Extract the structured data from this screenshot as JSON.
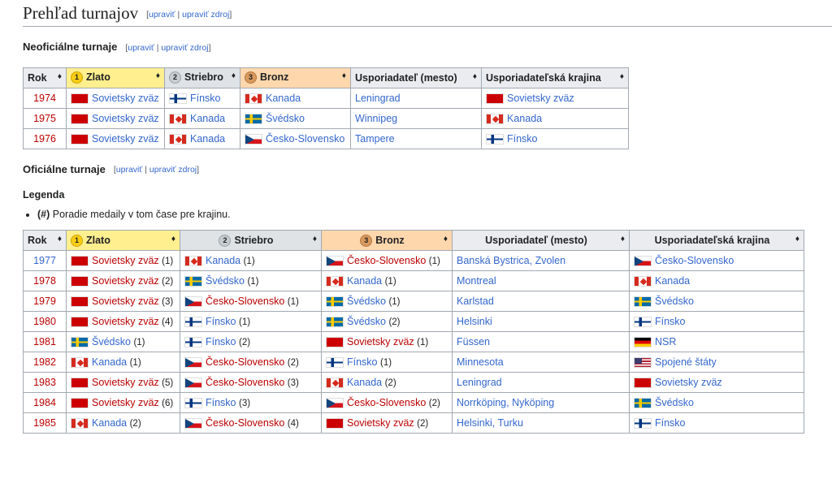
{
  "section_title": "Prehľad turnajov",
  "edit_labels": {
    "open": "[",
    "edit": "upraviť",
    "sep": " | ",
    "edit_src": "upraviť zdroj",
    "close": "]"
  },
  "unofficial": {
    "title": "Neoficiálne turnaje",
    "headers": [
      "Rok",
      "Zlato",
      "Striebro",
      "Bronz",
      "Usporiadateľ (mesto)",
      "Usporiadateľská krajina"
    ],
    "medal_numbers": [
      "1",
      "2",
      "3"
    ],
    "rows": [
      {
        "year": "1974",
        "gold": {
          "flag": "su",
          "name": "Sovietsky zväz"
        },
        "silver": {
          "flag": "fi",
          "name": "Fínsko"
        },
        "bronze": {
          "flag": "ca",
          "name": "Kanada"
        },
        "city": "Leningrad",
        "country": {
          "flag": "su",
          "name": "Sovietsky zväz"
        }
      },
      {
        "year": "1975",
        "gold": {
          "flag": "su",
          "name": "Sovietsky zväz"
        },
        "silver": {
          "flag": "ca",
          "name": "Kanada"
        },
        "bronze": {
          "flag": "se",
          "name": "Švédsko"
        },
        "city": "Winnipeg",
        "country": {
          "flag": "ca",
          "name": "Kanada"
        }
      },
      {
        "year": "1976",
        "gold": {
          "flag": "su",
          "name": "Sovietsky zväz"
        },
        "silver": {
          "flag": "ca",
          "name": "Kanada"
        },
        "bronze": {
          "flag": "cs",
          "name": "Česko-Slovensko"
        },
        "city": "Tampere",
        "country": {
          "flag": "fi",
          "name": "Fínsko"
        }
      }
    ]
  },
  "official": {
    "title": "Oficiálne turnaje",
    "legend_title": "Legenda",
    "legend_item_key": "(#)",
    "legend_item_text": " Poradie medaily v tom čase pre krajinu.",
    "headers": [
      "Rok",
      "Zlato",
      "Striebro",
      "Bronz",
      "Usporiadateľ (mesto)",
      "Usporiadateľská krajina"
    ],
    "rows": [
      {
        "year": "1977",
        "gold": {
          "flag": "su",
          "name": "Sovietsky zväz",
          "n": "(1)",
          "red": true
        },
        "silver": {
          "flag": "ca",
          "name": "Kanada",
          "n": "(1)"
        },
        "bronze": {
          "flag": "cs",
          "name": "Česko-Slovensko",
          "n": "(1)",
          "red": true
        },
        "city": "Banská Bystrica, Zvolen",
        "country": {
          "flag": "cs",
          "name": "Česko-Slovensko"
        }
      },
      {
        "year": "1978",
        "gold": {
          "flag": "su",
          "name": "Sovietsky zväz",
          "n": "(2)",
          "red": true
        },
        "silver": {
          "flag": "se",
          "name": "Švédsko",
          "n": "(1)"
        },
        "bronze": {
          "flag": "ca",
          "name": "Kanada",
          "n": "(1)"
        },
        "city": "Montreal",
        "country": {
          "flag": "ca",
          "name": "Kanada"
        }
      },
      {
        "year": "1979",
        "gold": {
          "flag": "su",
          "name": "Sovietsky zväz",
          "n": "(3)",
          "red": true
        },
        "silver": {
          "flag": "cs",
          "name": "Česko-Slovensko",
          "n": "(1)",
          "red": true
        },
        "bronze": {
          "flag": "se",
          "name": "Švédsko",
          "n": "(1)"
        },
        "city": "Karlstad",
        "country": {
          "flag": "se",
          "name": "Švédsko"
        }
      },
      {
        "year": "1980",
        "gold": {
          "flag": "su",
          "name": "Sovietsky zväz",
          "n": "(4)",
          "red": true
        },
        "silver": {
          "flag": "fi",
          "name": "Fínsko",
          "n": "(1)"
        },
        "bronze": {
          "flag": "se",
          "name": "Švédsko",
          "n": "(2)"
        },
        "city": "Helsinki",
        "country": {
          "flag": "fi",
          "name": "Fínsko"
        }
      },
      {
        "year": "1981",
        "gold": {
          "flag": "se",
          "name": "Švédsko",
          "n": "(1)"
        },
        "silver": {
          "flag": "fi",
          "name": "Fínsko",
          "n": "(2)"
        },
        "bronze": {
          "flag": "su",
          "name": "Sovietsky zväz",
          "n": "(1)",
          "red": true
        },
        "city": "Füssen",
        "country": {
          "flag": "de",
          "name": "NSR"
        }
      },
      {
        "year": "1982",
        "gold": {
          "flag": "ca",
          "name": "Kanada",
          "n": "(1)"
        },
        "silver": {
          "flag": "cs",
          "name": "Česko-Slovensko",
          "n": "(2)",
          "red": true
        },
        "bronze": {
          "flag": "fi",
          "name": "Fínsko",
          "n": "(1)"
        },
        "city": "Minnesota",
        "country": {
          "flag": "us",
          "name": "Spojené štáty"
        }
      },
      {
        "year": "1983",
        "gold": {
          "flag": "su",
          "name": "Sovietsky zväz",
          "n": "(5)",
          "red": true
        },
        "silver": {
          "flag": "cs",
          "name": "Česko-Slovensko",
          "n": "(3)",
          "red": true
        },
        "bronze": {
          "flag": "ca",
          "name": "Kanada",
          "n": "(2)"
        },
        "city": "Leningrad",
        "country": {
          "flag": "su",
          "name": "Sovietsky zväz"
        }
      },
      {
        "year": "1984",
        "gold": {
          "flag": "su",
          "name": "Sovietsky zväz",
          "n": "(6)",
          "red": true
        },
        "silver": {
          "flag": "fi",
          "name": "Fínsko",
          "n": "(3)"
        },
        "bronze": {
          "flag": "cs",
          "name": "Česko-Slovensko",
          "n": "(2)",
          "red": true
        },
        "city": "Norrköping, Nyköping",
        "country": {
          "flag": "se",
          "name": "Švédsko"
        }
      },
      {
        "year": "1985",
        "gold": {
          "flag": "ca",
          "name": "Kanada",
          "n": "(2)"
        },
        "silver": {
          "flag": "cs",
          "name": "Česko-Slovensko",
          "n": "(4)",
          "red": true
        },
        "bronze": {
          "flag": "su",
          "name": "Sovietsky zväz",
          "n": "(2)",
          "red": true
        },
        "city": "Helsinki, Turku",
        "country": {
          "flag": "fi",
          "name": "Fínsko"
        }
      }
    ]
  },
  "colors": {
    "link": "#3366cc",
    "redlink": "#ba0000",
    "gold": "#ffef8f",
    "silver": "#dfe3e6",
    "bronze": "#ffd7ad",
    "header": "#eaecf0"
  }
}
